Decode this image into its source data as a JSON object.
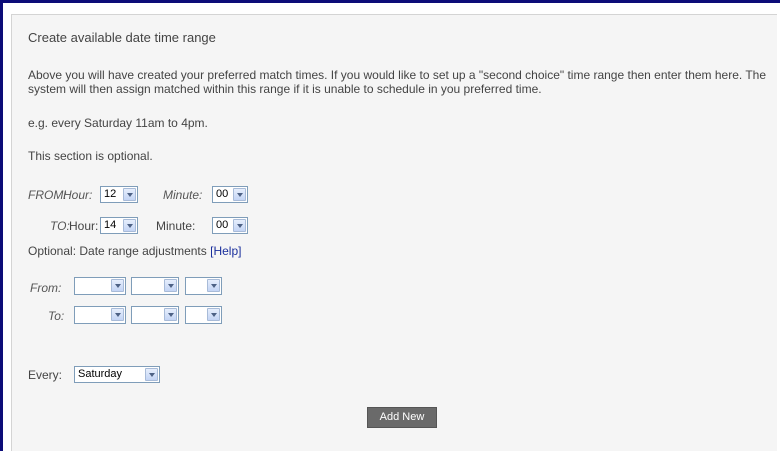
{
  "form": {
    "title": "Create available date time range",
    "intro": "Above you will have created your preferred match times. If you would like to set up a \"second choice\" time range then enter them here. The system will then assign matched within this range if it is unable to schedule in you preferred time.",
    "example": "e.g. every Saturday 11am to 4pm.",
    "optional_note": "This section is optional.",
    "from_time": {
      "label": "FROM:",
      "hour_label": "Hour:",
      "hour_value": "12",
      "minute_label": "Minute:",
      "minute_value": "00"
    },
    "to_time": {
      "label": "TO:",
      "hour_label": "Hour:",
      "hour_value": "14",
      "minute_label": "Minute:",
      "minute_value": "00"
    },
    "date_range_text": "Optional: Date range adjustments",
    "help_link": "[Help]",
    "from_date_label": "From:",
    "to_date_label": "To:",
    "every_label": "Every:",
    "every_value": "Saturday",
    "add_button": "Add New"
  }
}
